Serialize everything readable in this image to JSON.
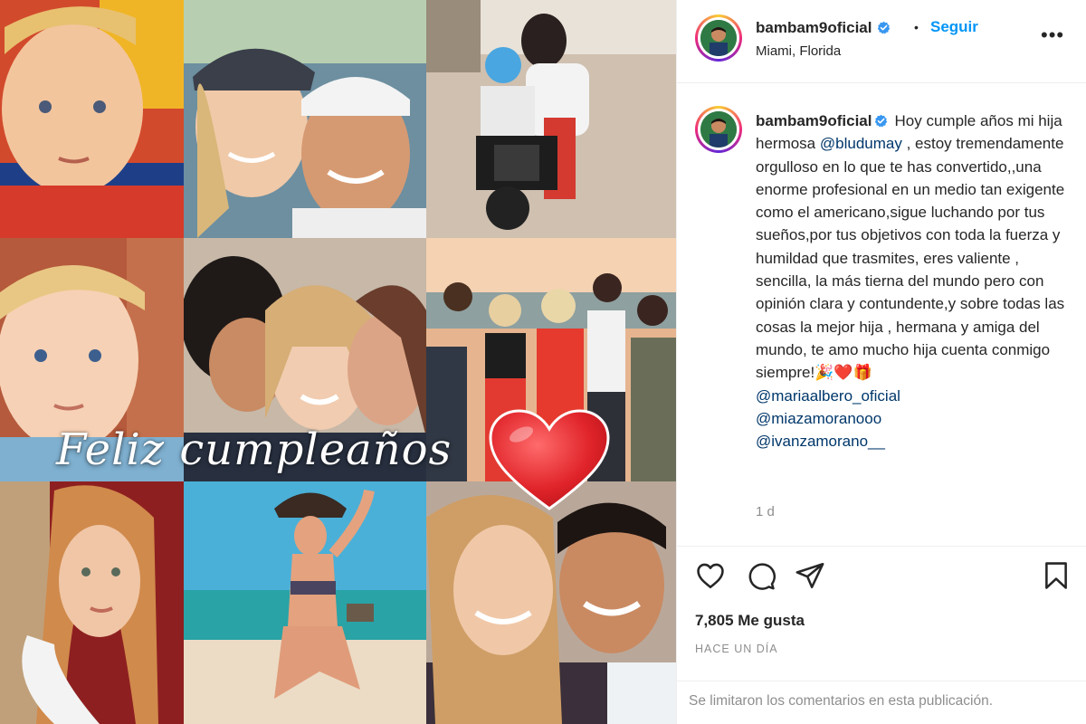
{
  "post": {
    "image_overlay_text": "Feliz cumpleaños",
    "image_alt": "Birthday photo collage"
  },
  "header": {
    "username": "bambam9oficial",
    "separator": "•",
    "follow_label": "Seguir",
    "location": "Miami, Florida",
    "more_label": "•••"
  },
  "caption": {
    "username": "bambam9oficial",
    "text_1": "Hoy cumple años mi hija hermosa ",
    "mention_1": "@bludumay",
    "text_2": " , estoy tremendamente orgulloso en lo que te has convertido,,una enorme profesional en un medio tan exigente como el americano,sigue luchando por tus sueños,por tus objetivos con toda la fuerza y humildad que trasmites, eres valiente , sencilla, la más tierna del mundo pero con opinión clara y contundente,y sobre todas las cosas la mejor hija , hermana y amiga del mundo, te amo mucho hija cuenta conmigo siempre!",
    "emoji": "🎉❤️🎁",
    "mentions": [
      "@mariaalbero_oficial",
      "@miazamoranooo",
      "@ivanzamorano__"
    ],
    "time_ago": "1 d"
  },
  "actions": {
    "likes": "7,805 Me gusta",
    "date": "HACE UN DÍA",
    "comments_limited": "Se limitaron los comentarios en esta publicación."
  },
  "colors": {
    "link_blue": "#0095f6",
    "mention_blue": "#00376b",
    "verified_blue": "#3897f0",
    "muted_gray": "#8e8e8e",
    "heart_red": "#e0242a"
  },
  "icons": [
    "verified-badge-icon",
    "heart-icon",
    "comment-icon",
    "share-icon",
    "bookmark-icon",
    "more-icon"
  ]
}
